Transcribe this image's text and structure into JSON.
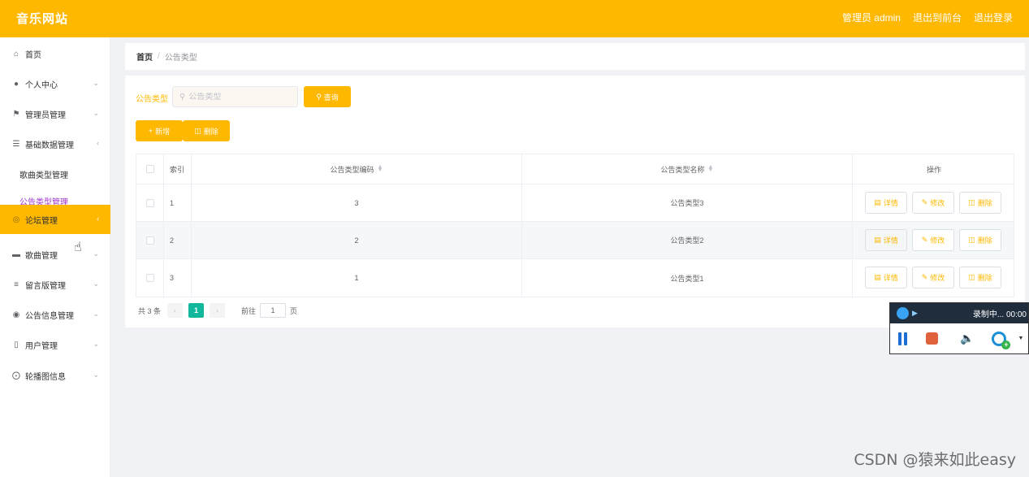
{
  "header": {
    "brand": "音乐网站",
    "admin_label": "管理员 admin",
    "to_front": "退出到前台",
    "logout": "退出登录"
  },
  "sidebar": {
    "items": [
      {
        "label": "首页",
        "icon": "home-icon",
        "has_arrow": false
      },
      {
        "label": "个人中心",
        "icon": "user-icon",
        "has_arrow": true
      },
      {
        "label": "管理员管理",
        "icon": "flag-icon",
        "has_arrow": true
      },
      {
        "label": "基础数据管理",
        "icon": "list-icon",
        "has_arrow": true
      },
      {
        "label": "论坛管理",
        "icon": "forum-icon",
        "has_arrow": true
      },
      {
        "label": "歌曲管理",
        "icon": "monitor-icon",
        "has_arrow": true
      },
      {
        "label": "留言版管理",
        "icon": "sliders-icon",
        "has_arrow": true
      },
      {
        "label": "公告信息管理",
        "icon": "location-icon",
        "has_arrow": true
      },
      {
        "label": "用户管理",
        "icon": "phone-icon",
        "has_arrow": true
      },
      {
        "label": "轮播图信息",
        "icon": "compass-icon",
        "has_arrow": true
      }
    ],
    "sub_items": [
      {
        "label": "歌曲类型管理"
      },
      {
        "label": "公告类型管理"
      }
    ],
    "active_item": "论坛管理",
    "current_sub_item": "公告类型管理"
  },
  "breadcrumb": {
    "home": "首页",
    "separator": "/",
    "current": "公告类型"
  },
  "search": {
    "label": "公告类型",
    "placeholder": "公告类型",
    "value": "",
    "button": "查询"
  },
  "actions": {
    "add": "新增",
    "delete": "删除"
  },
  "table": {
    "headers": {
      "index": "索引",
      "code": "公告类型编码",
      "name": "公告类型名称",
      "ops": "操作"
    },
    "rows": [
      {
        "index": "1",
        "code": "3",
        "name": "公告类型3"
      },
      {
        "index": "2",
        "code": "2",
        "name": "公告类型2"
      },
      {
        "index": "3",
        "code": "1",
        "name": "公告类型1"
      }
    ],
    "row_buttons": {
      "detail": "详情",
      "edit": "修改",
      "delete": "删除"
    }
  },
  "pagination": {
    "total": "共 3 条",
    "prev": "‹",
    "current_page": "1",
    "next": "›",
    "goto_label": "前往",
    "goto_value": "1",
    "page_suffix": "页"
  },
  "recorder": {
    "status": "录制中... 00:00"
  },
  "watermark": "CSDN @猿来如此easy",
  "colors": {
    "accent": "#ffb800",
    "page_active": "#13b89c",
    "submenu_current": "#a033cc"
  }
}
